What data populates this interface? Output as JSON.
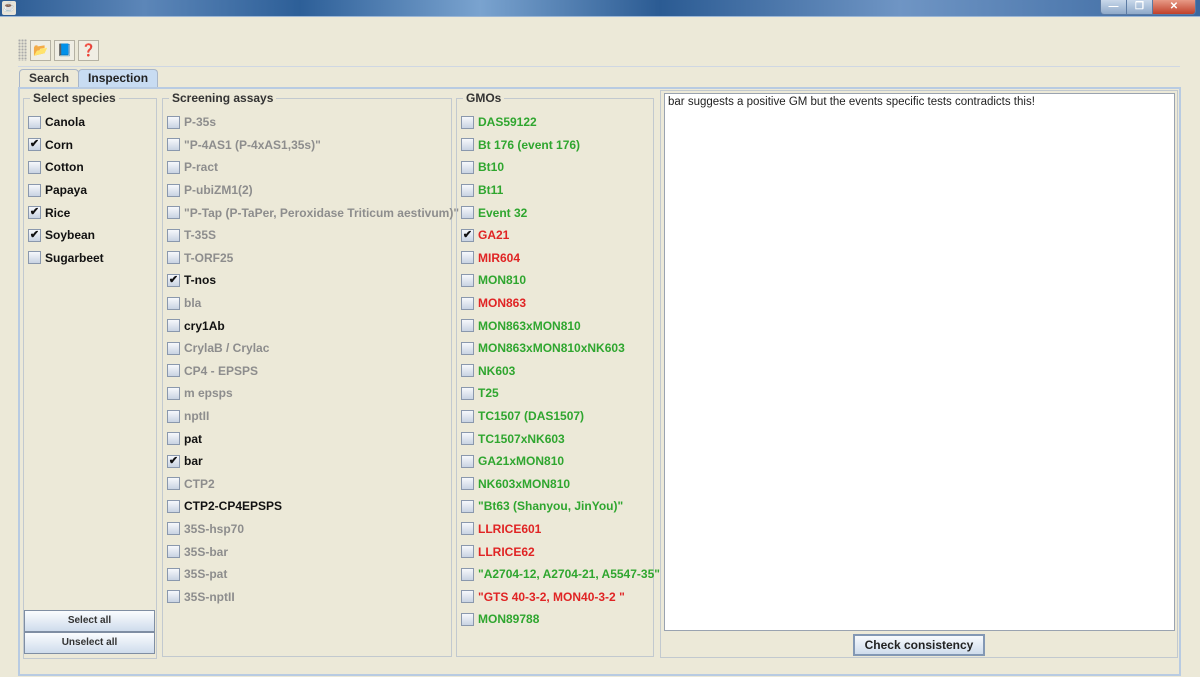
{
  "window": {
    "title": "",
    "controls": {
      "minimize": "—",
      "restore": "❐",
      "close": "✕"
    }
  },
  "toolbar": {
    "buttons": [
      {
        "name": "open",
        "icon": "folder-open-icon",
        "glyph": "📂"
      },
      {
        "name": "notebook",
        "icon": "notebook-icon",
        "glyph": "📘"
      },
      {
        "name": "help",
        "icon": "help-icon",
        "glyph": "❓"
      }
    ]
  },
  "tabs": [
    {
      "label": "Search",
      "active": false
    },
    {
      "label": "Inspection",
      "active": true
    }
  ],
  "species": {
    "title": "Select species",
    "items": [
      {
        "label": "Canola",
        "checked": false
      },
      {
        "label": "Corn",
        "checked": true
      },
      {
        "label": "Cotton",
        "checked": false
      },
      {
        "label": "Papaya",
        "checked": false
      },
      {
        "label": "Rice",
        "checked": true
      },
      {
        "label": "Soybean",
        "checked": true
      },
      {
        "label": "Sugarbeet",
        "checked": false
      }
    ],
    "select_all": "Select all",
    "unselect_all": "Unselect all"
  },
  "screening": {
    "title": "Screening assays",
    "items": [
      {
        "label": "P-35s",
        "checked": false,
        "style": "muted"
      },
      {
        "label": "\"P-4AS1 (P-4xAS1,35s)\"",
        "checked": false,
        "style": "muted"
      },
      {
        "label": "P-ract",
        "checked": false,
        "style": "muted"
      },
      {
        "label": "P-ubiZM1(2)",
        "checked": false,
        "style": "muted"
      },
      {
        "label": "\"P-Tap (P-TaPer, Peroxidase Triticum aestivum)\"",
        "checked": false,
        "style": "muted"
      },
      {
        "label": "T-35S",
        "checked": false,
        "style": "muted"
      },
      {
        "label": "T-ORF25",
        "checked": false,
        "style": "muted"
      },
      {
        "label": "T-nos",
        "checked": true,
        "style": "dark"
      },
      {
        "label": "bla",
        "checked": false,
        "style": "muted"
      },
      {
        "label": "cry1Ab",
        "checked": false,
        "style": "dark"
      },
      {
        "label": "CrylaB / Crylac",
        "checked": false,
        "style": "muted"
      },
      {
        "label": "CP4 - EPSPS",
        "checked": false,
        "style": "muted"
      },
      {
        "label": "m epsps",
        "checked": false,
        "style": "muted"
      },
      {
        "label": "nptII",
        "checked": false,
        "style": "muted"
      },
      {
        "label": "pat",
        "checked": false,
        "style": "dark"
      },
      {
        "label": "bar",
        "checked": true,
        "style": "dark"
      },
      {
        "label": "CTP2",
        "checked": false,
        "style": "muted"
      },
      {
        "label": "CTP2-CP4EPSPS",
        "checked": false,
        "style": "dark"
      },
      {
        "label": "35S-hsp70",
        "checked": false,
        "style": "muted"
      },
      {
        "label": "35S-bar",
        "checked": false,
        "style": "muted"
      },
      {
        "label": "35S-pat",
        "checked": false,
        "style": "muted"
      },
      {
        "label": "35S-nptII",
        "checked": false,
        "style": "muted"
      }
    ]
  },
  "gmos": {
    "title": "GMOs",
    "items": [
      {
        "label": "DAS59122",
        "checked": false,
        "style": "green"
      },
      {
        "label": "Bt 176 (event 176)",
        "checked": false,
        "style": "green"
      },
      {
        "label": "Bt10",
        "checked": false,
        "style": "green"
      },
      {
        "label": "Bt11",
        "checked": false,
        "style": "green"
      },
      {
        "label": "Event 32",
        "checked": false,
        "style": "green"
      },
      {
        "label": "GA21",
        "checked": true,
        "style": "red"
      },
      {
        "label": "MIR604",
        "checked": false,
        "style": "red"
      },
      {
        "label": "MON810",
        "checked": false,
        "style": "green"
      },
      {
        "label": "MON863",
        "checked": false,
        "style": "red"
      },
      {
        "label": "MON863xMON810",
        "checked": false,
        "style": "green"
      },
      {
        "label": "MON863xMON810xNK603",
        "checked": false,
        "style": "green"
      },
      {
        "label": "NK603",
        "checked": false,
        "style": "green"
      },
      {
        "label": "T25",
        "checked": false,
        "style": "green"
      },
      {
        "label": "TC1507 (DAS1507)",
        "checked": false,
        "style": "green"
      },
      {
        "label": "TC1507xNK603",
        "checked": false,
        "style": "green"
      },
      {
        "label": "GA21xMON810",
        "checked": false,
        "style": "green"
      },
      {
        "label": "NK603xMON810",
        "checked": false,
        "style": "green"
      },
      {
        "label": "\"Bt63 (Shanyou, JinYou)\"",
        "checked": false,
        "style": "green"
      },
      {
        "label": "LLRICE601",
        "checked": false,
        "style": "red"
      },
      {
        "label": "LLRICE62",
        "checked": false,
        "style": "red"
      },
      {
        "label": "\"A2704-12, A2704-21, A5547-35\"",
        "checked": false,
        "style": "green"
      },
      {
        "label": "\"GTS 40-3-2, MON40-3-2 \"",
        "checked": false,
        "style": "red"
      },
      {
        "label": "MON89788",
        "checked": false,
        "style": "green"
      }
    ]
  },
  "result": {
    "text": "bar suggests a positive GM but the events specific tests contradicts this!",
    "check_button": "Check consistency"
  },
  "colors": {
    "green": "#2fa62f",
    "red": "#e02424",
    "muted": "#8d8d8d",
    "background": "#ECE9D8"
  }
}
